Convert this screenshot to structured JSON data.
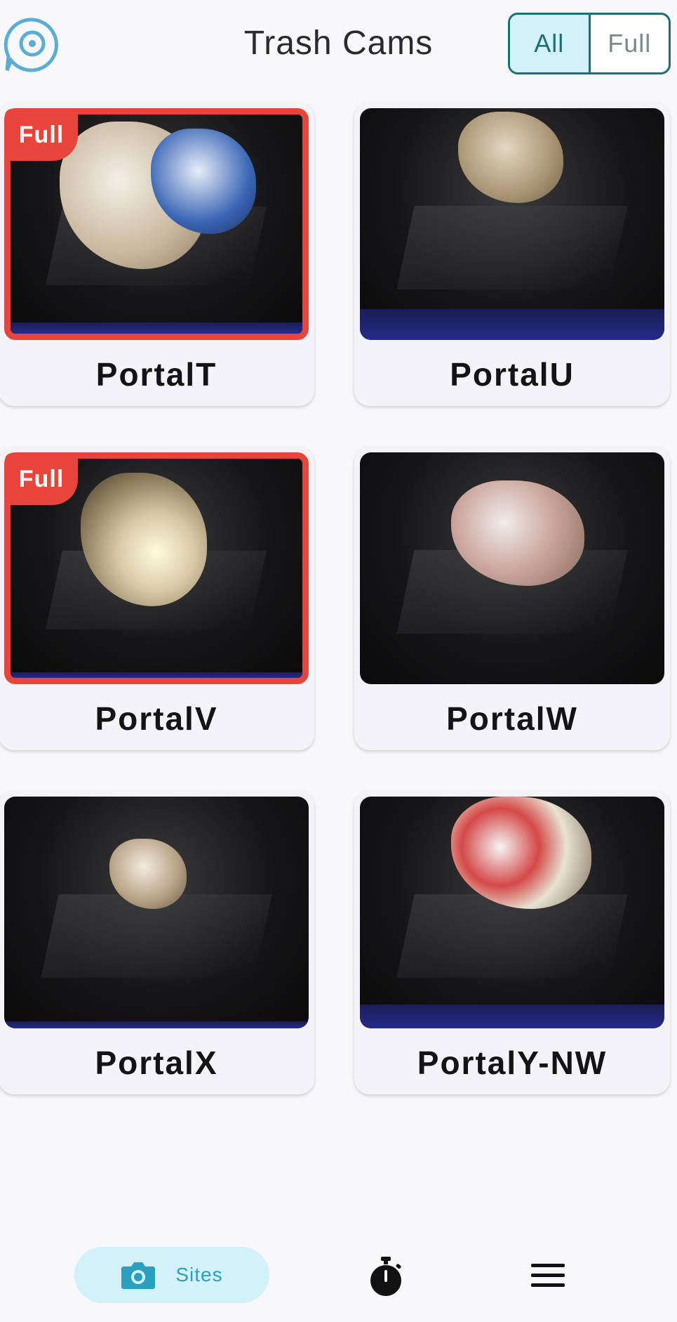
{
  "header": {
    "title": "Trash Cams",
    "filter": {
      "options": [
        "All",
        "Full"
      ],
      "selected": "All"
    }
  },
  "cards": [
    {
      "name": "PortalT",
      "full": true,
      "badge": "Full"
    },
    {
      "name": "PortalU",
      "full": false,
      "badge": ""
    },
    {
      "name": "PortalV",
      "full": true,
      "badge": "Full"
    },
    {
      "name": "PortalW",
      "full": false,
      "badge": ""
    },
    {
      "name": "PortalX",
      "full": false,
      "badge": ""
    },
    {
      "name": "PortalY-NW",
      "full": false,
      "badge": ""
    }
  ],
  "nav": {
    "sites_label": "Sites",
    "icons": [
      "camera-icon",
      "stopwatch-icon",
      "menu-icon"
    ]
  },
  "colors": {
    "accent": "#1e6f74",
    "accent_light": "#d2f1f8",
    "full_alert": "#e8453a",
    "nav_text": "#2a9fc0"
  }
}
